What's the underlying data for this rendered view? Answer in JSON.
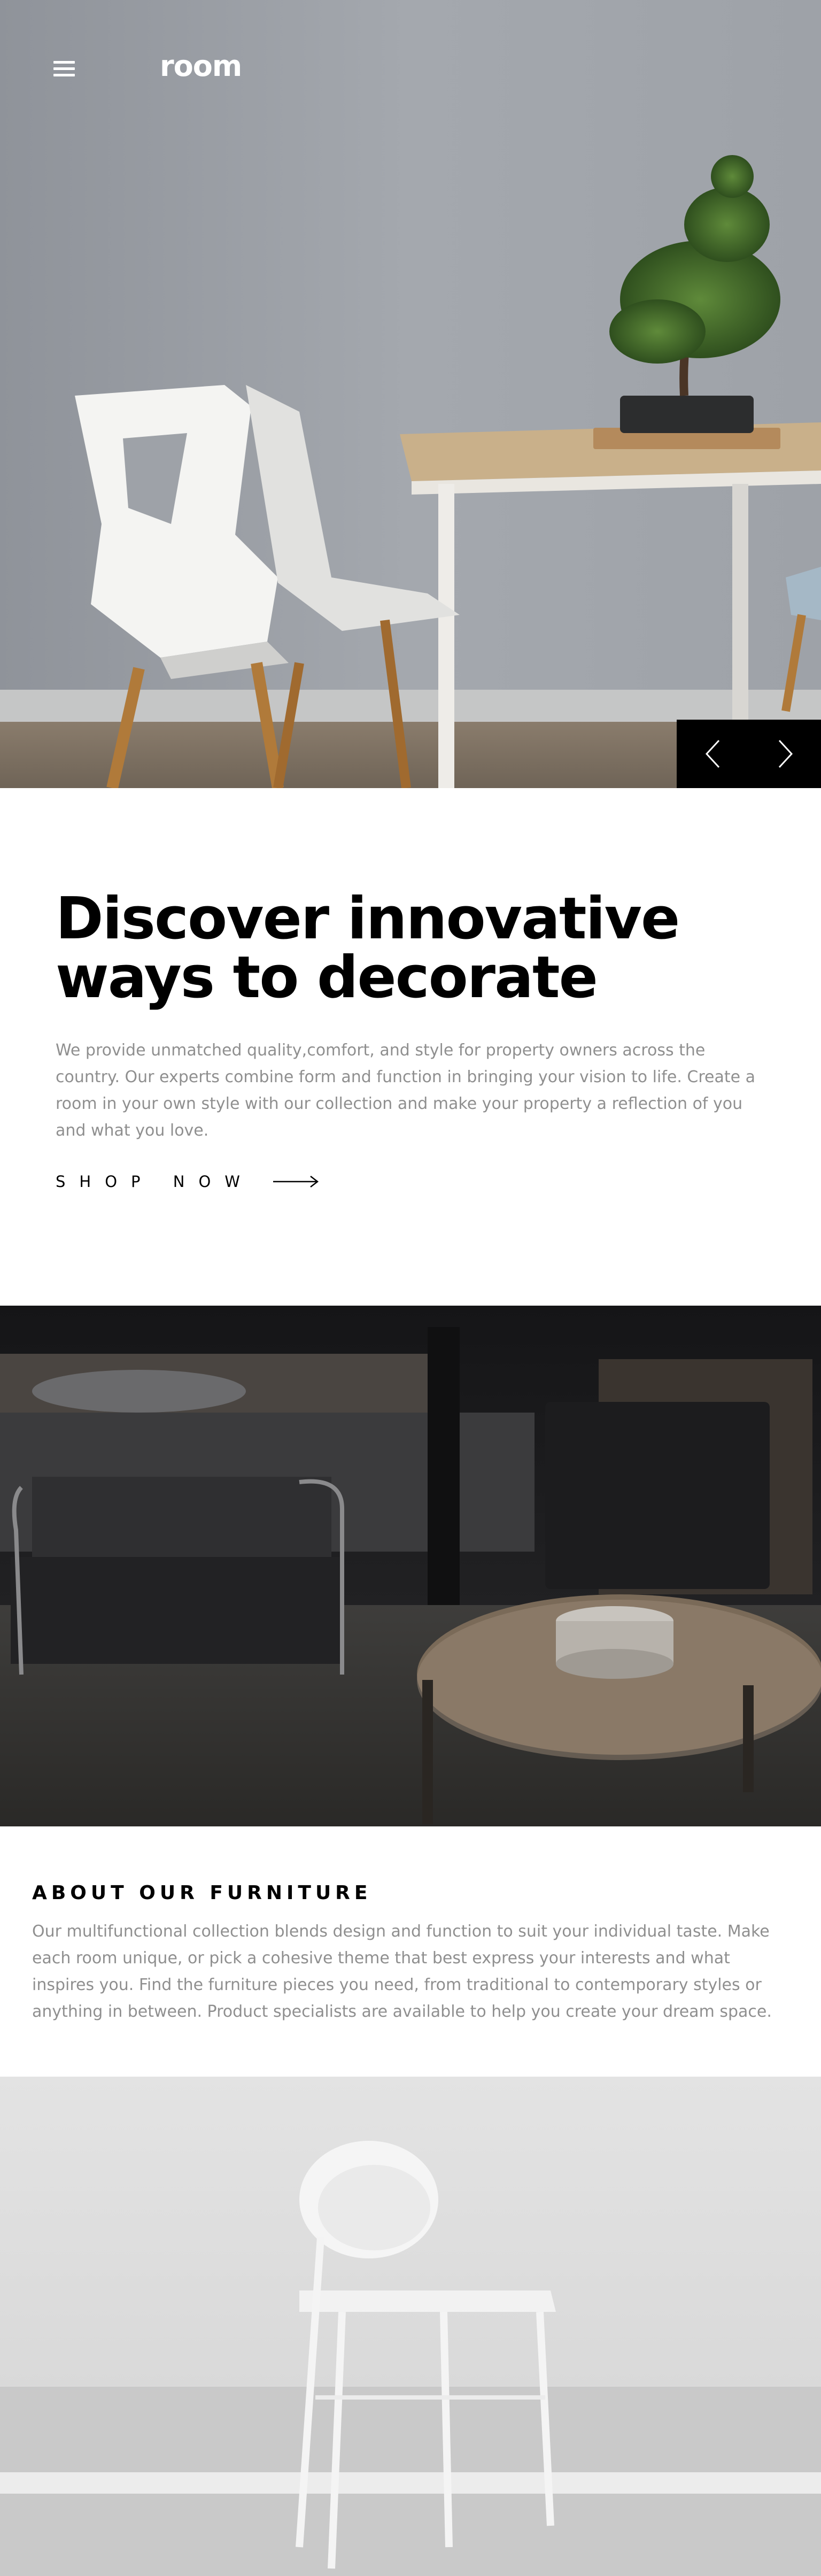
{
  "header": {
    "logo": "room",
    "menu_icon": "hamburger-menu-icon"
  },
  "hero": {
    "image_alt": "white-chair-table-bonsai",
    "prev_icon": "chevron-left-icon",
    "next_icon": "chevron-right-icon"
  },
  "intro": {
    "title": "Discover innovative ways to decorate",
    "body": "We provide unmatched quality,comfort, and style for property owners across the country. Our experts combine form and function in bringing your vision to life. Create a room in your own style with our collection and make your property a reflection of you and what you love.",
    "cta_label": "SHOP NOW",
    "cta_icon": "arrow-right-icon"
  },
  "about": {
    "title": "ABOUT OUR FURNITURE",
    "body": "Our multifunctional collection blends design and function to suit your individual taste. Make each room unique, or pick a cohesive theme that best express your interests and what inspires you. Find the furniture pieces you need, from traditional to contemporary styles or anything in between. Product specialists are available to help you create your dream space."
  },
  "colors": {
    "text_primary": "#000000",
    "text_muted": "#8f8f8f",
    "slider_bg": "#000000"
  }
}
